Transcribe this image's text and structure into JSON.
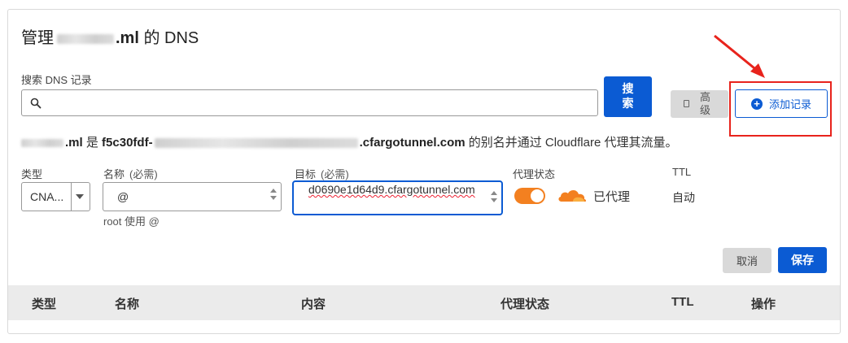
{
  "header": {
    "title_prefix": "管理",
    "title_domain_suffix": ".ml",
    "title_suffix": "的 DNS"
  },
  "search": {
    "label": "搜索 DNS 记录",
    "value": "",
    "placeholder": "",
    "search_button_label": "搜索",
    "advanced_button_label": "高级",
    "add_record_button_label": "添加记录"
  },
  "info": {
    "domain_suffix": ".ml",
    "is_text": "是",
    "target_prefix": "f5c30fdf-",
    "target_suffix": ".cfargotunnel.com",
    "tail_text": "的别名并通过 Cloudflare 代理其流量。"
  },
  "form": {
    "type_label": "类型",
    "type_value": "CNA...",
    "name_label": "名称",
    "required_hint": "(必需)",
    "name_value": "@",
    "name_hint": "root 使用 @",
    "target_label": "目标",
    "target_value": "d0690e1d64d9.cfargotunnel.com",
    "proxy_label": "代理状态",
    "proxy_on": true,
    "proxy_status_text": "已代理",
    "ttl_label": "TTL",
    "ttl_value": "自动",
    "cancel_label": "取消",
    "save_label": "保存"
  },
  "table": {
    "columns": [
      "类型",
      "名称",
      "内容",
      "代理状态",
      "TTL",
      "操作"
    ]
  },
  "colors": {
    "primary": "#0b5bd3",
    "proxy_orange": "#f38020",
    "annotation_red": "#e8231c"
  }
}
